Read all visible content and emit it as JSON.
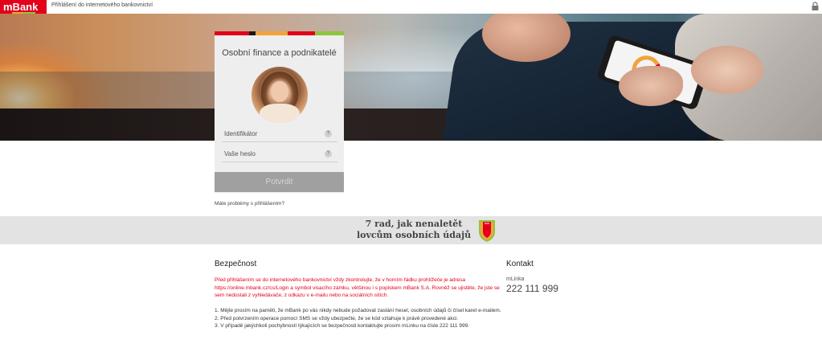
{
  "topbar": {
    "logo": "mBank",
    "title": "Přihlášení do internetového bankovnictví",
    "stripe_colors": [
      "#e2001a",
      "#f2a33a",
      "#8dc63f",
      "#e2001a"
    ]
  },
  "login": {
    "colorbar": [
      "#e2001a",
      "#1a1a1a",
      "#f2a33a",
      "#e2001a",
      "#8dc63f"
    ],
    "heading": "Osobní finance a podnikatelé",
    "fields": [
      {
        "label": "Identifikátor",
        "help": "?"
      },
      {
        "label": "Vaše heslo",
        "help": "?"
      }
    ],
    "submit_label": "Potvrdit",
    "problems_link": "Máte problémy s přihlášením?"
  },
  "banner": {
    "line1": "7 rad, jak nenaletět",
    "line2": "lovcům osobních údajů"
  },
  "security": {
    "title": "Bezpečnost",
    "warning": "Před přihlášením se do internetového bankovnictví vždy zkontrolujte, že v horním řádku prohlížeče je adresa https://online.mbank.cz/cs/Login a symbol visacího zámku, většinou i s popiskem mBank S.A. Rovněž se ujistěte, že jste se sem nedostali z vyhledávače, z odkazu v e-mailu nebo na sociálních sítích.",
    "items": [
      "1. Mějte prosím na paměti, že mBank po vás nikdy nebude požadovat zaslání hesel, osobních údajů či čísel karet e-mailem.",
      "2. Před potvrzením operace pomocí SMS se vždy ubezpečte, že se kód vztahuje k právě provedené akci.",
      "3. V případě jakýchkoli pochybností týkajících se bezpečnosti kontaktujte prosím mLinku na čísle 222 111 999."
    ]
  },
  "contact": {
    "title": "Kontakt",
    "label": "mLinka",
    "phone": "222 111 999"
  },
  "colors": {
    "brand": "#e2001a",
    "accent_orange": "#f2a33a",
    "accent_green": "#8dc63f"
  }
}
